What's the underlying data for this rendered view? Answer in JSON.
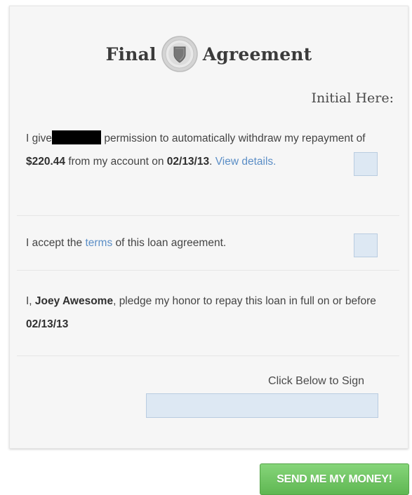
{
  "title": {
    "left_word": "Final",
    "right_word": "Agreement",
    "seal_icon": "shield-seal-icon"
  },
  "initial_header": "Initial Here:",
  "withdraw_section": {
    "t1": "I give",
    "t2": " permission to automatically withdraw my repayment of ",
    "amount": "$220.44",
    "t3": " from my account on ",
    "date": "02/13/13",
    "t4": ". ",
    "link": "View details."
  },
  "terms_section": {
    "t1": "I accept the ",
    "link": "terms",
    "t2": " of this loan agreement."
  },
  "pledge_section": {
    "t1": "I, ",
    "name": "Joey Awesome",
    "t2": ", pledge my honor to repay this loan in full on or before ",
    "date": "02/13/13"
  },
  "sign": {
    "label": "Click Below to Sign"
  },
  "submit_button": {
    "label": "SEND ME MY MONEY!"
  },
  "colors": {
    "link": "#5b8ec6",
    "input_fill": "#dde8f3",
    "button_green": "#6cc25f"
  }
}
